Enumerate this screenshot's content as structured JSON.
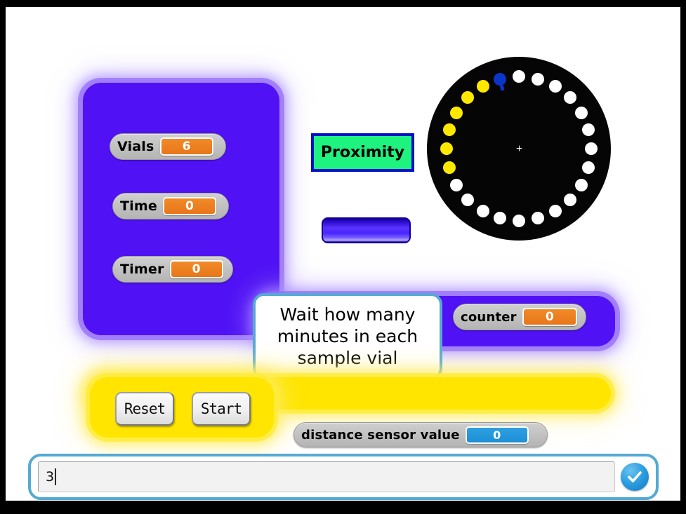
{
  "stage": {
    "background_color": "#ffffff",
    "frame_color": "#000000"
  },
  "variable_panel": {
    "panel_color": "#5012f5",
    "glow_color": "#ae8cff",
    "readouts": [
      {
        "label": "Vials",
        "value": "6",
        "value_color": "#e8761a"
      },
      {
        "label": "Time",
        "value": "0",
        "value_color": "#e8761a"
      },
      {
        "label": "Timer",
        "value": "0",
        "value_color": "#e8761a"
      }
    ]
  },
  "counter_panel": {
    "panel_color": "#5012f5",
    "readout": {
      "label": "counter",
      "value": "0",
      "value_color": "#e8761a"
    }
  },
  "distance_readout": {
    "label": "distance sensor value",
    "value": "0",
    "value_color": "#1d8fd6"
  },
  "proximity_label": {
    "text": "Proximity",
    "fill_color": "#1ef27f",
    "border_color": "#0010c8"
  },
  "blue_bar_sprite": {
    "name": "blue-bar-sprite",
    "color": "#4824ff"
  },
  "carousel": {
    "name": "vial-carousel",
    "body_color": "#050505",
    "hole_count": 24,
    "center_marker": "+",
    "holes": [
      {
        "index": 0,
        "color": "white"
      },
      {
        "index": 1,
        "color": "white"
      },
      {
        "index": 2,
        "color": "white"
      },
      {
        "index": 3,
        "color": "white"
      },
      {
        "index": 4,
        "color": "white"
      },
      {
        "index": 5,
        "color": "white"
      },
      {
        "index": 6,
        "color": "white"
      },
      {
        "index": 7,
        "color": "white"
      },
      {
        "index": 8,
        "color": "white"
      },
      {
        "index": 9,
        "color": "white"
      },
      {
        "index": 10,
        "color": "white"
      },
      {
        "index": 11,
        "color": "white"
      },
      {
        "index": 12,
        "color": "white"
      },
      {
        "index": 13,
        "color": "white"
      },
      {
        "index": 14,
        "color": "white"
      },
      {
        "index": 15,
        "color": "white"
      },
      {
        "index": 16,
        "color": "white"
      },
      {
        "index": 17,
        "color": "yellow"
      },
      {
        "index": 18,
        "color": "yellow"
      },
      {
        "index": 19,
        "color": "yellow"
      },
      {
        "index": 20,
        "color": "yellow"
      },
      {
        "index": 21,
        "color": "yellow"
      },
      {
        "index": 22,
        "color": "yellow"
      },
      {
        "index": 23,
        "color": "blue"
      }
    ]
  },
  "speech_bubble": {
    "text": "Wait how many minutes in each sample vial",
    "border_color": "#55aad4",
    "fill_color": "#ffffff"
  },
  "control_panel": {
    "panel_color": "#ffe500",
    "buttons": [
      {
        "label": "Reset",
        "name": "reset-button"
      },
      {
        "label": "Start",
        "name": "start-button"
      }
    ]
  },
  "ask_prompt": {
    "value": "3",
    "placeholder": "",
    "submit_icon": "checkmark-icon",
    "border_color": "#55aad4",
    "submit_color": "#2e9fe0"
  }
}
